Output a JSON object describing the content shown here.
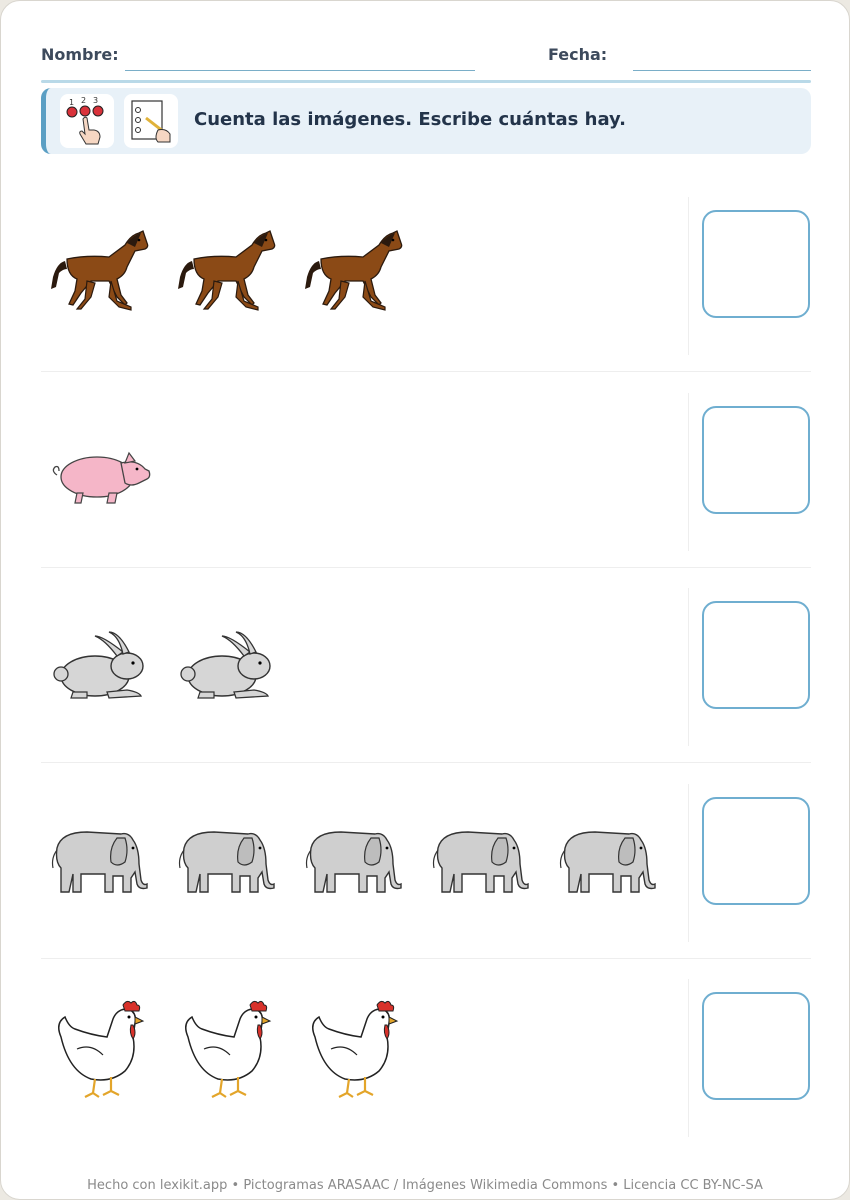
{
  "header": {
    "name_label": "Nombre:",
    "date_label": "Fecha:"
  },
  "instruction": {
    "text": "Cuenta las imágenes. Escribe cuántas hay.",
    "icons": [
      "count-pictogram-icon",
      "write-pictogram-icon"
    ]
  },
  "rows": [
    {
      "animal": "horse",
      "count": 3
    },
    {
      "animal": "pig",
      "count": 1
    },
    {
      "animal": "rabbit",
      "count": 2
    },
    {
      "animal": "elephant",
      "count": 5
    },
    {
      "animal": "chicken",
      "count": 3
    }
  ],
  "colors": {
    "accent": "#5b9fc4",
    "box_border": "#6faed0",
    "instruction_bg": "#e8f1f8"
  },
  "footer": {
    "text": "Hecho con lexikit.app • Pictogramas ARASAAC / Imágenes Wikimedia Commons • Licencia CC BY-NC-SA"
  }
}
